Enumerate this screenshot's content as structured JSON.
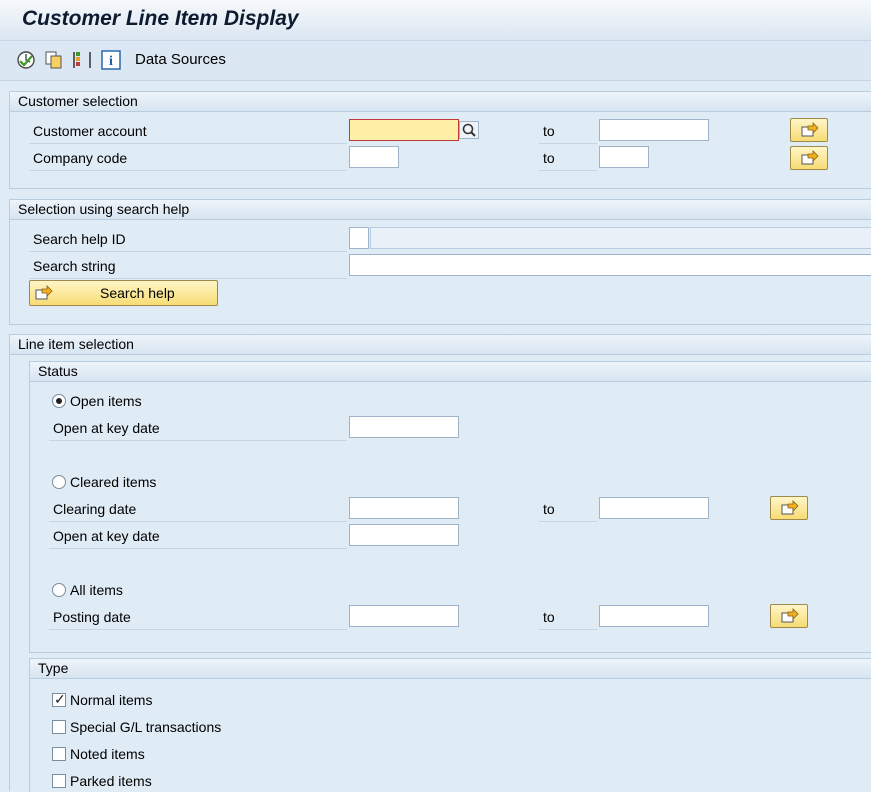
{
  "window": {
    "title": "Customer Line Item Display"
  },
  "toolbar": {
    "icons": [
      "execute-icon",
      "copy-icon",
      "layout-icon",
      "info-icon"
    ],
    "data_sources_label": "Data Sources"
  },
  "customer_selection": {
    "title": "Customer selection",
    "customer_account_label": "Customer account",
    "company_code_label": "Company code",
    "to_label": "to",
    "customer_account_from": "",
    "customer_account_to": "",
    "company_code_from": "",
    "company_code_to": ""
  },
  "search_help": {
    "title": "Selection using search help",
    "search_help_id_label": "Search help ID",
    "search_string_label": "Search string",
    "search_help_button": "Search help",
    "search_help_id": "",
    "search_string": ""
  },
  "line_item_selection": {
    "title": "Line item selection",
    "status": {
      "title": "Status",
      "open_items_label": "Open items",
      "open_at_key_date_label": "Open at key date",
      "cleared_items_label": "Cleared items",
      "clearing_date_label": "Clearing date",
      "open_at_key_date2_label": "Open at key date",
      "all_items_label": "All items",
      "posting_date_label": "Posting date",
      "to_label": "to",
      "selected": "open_items"
    },
    "type": {
      "title": "Type",
      "normal_items_label": "Normal items",
      "special_gl_label": "Special G/L transactions",
      "noted_items_label": "Noted items",
      "parked_items_label": "Parked items",
      "checked": {
        "normal": true,
        "special_gl": false,
        "noted": false,
        "parked": false
      }
    }
  },
  "colors": {
    "accent_button": "#f7dc74",
    "background": "#dfebf5",
    "required_field": "#fdf0a6"
  }
}
